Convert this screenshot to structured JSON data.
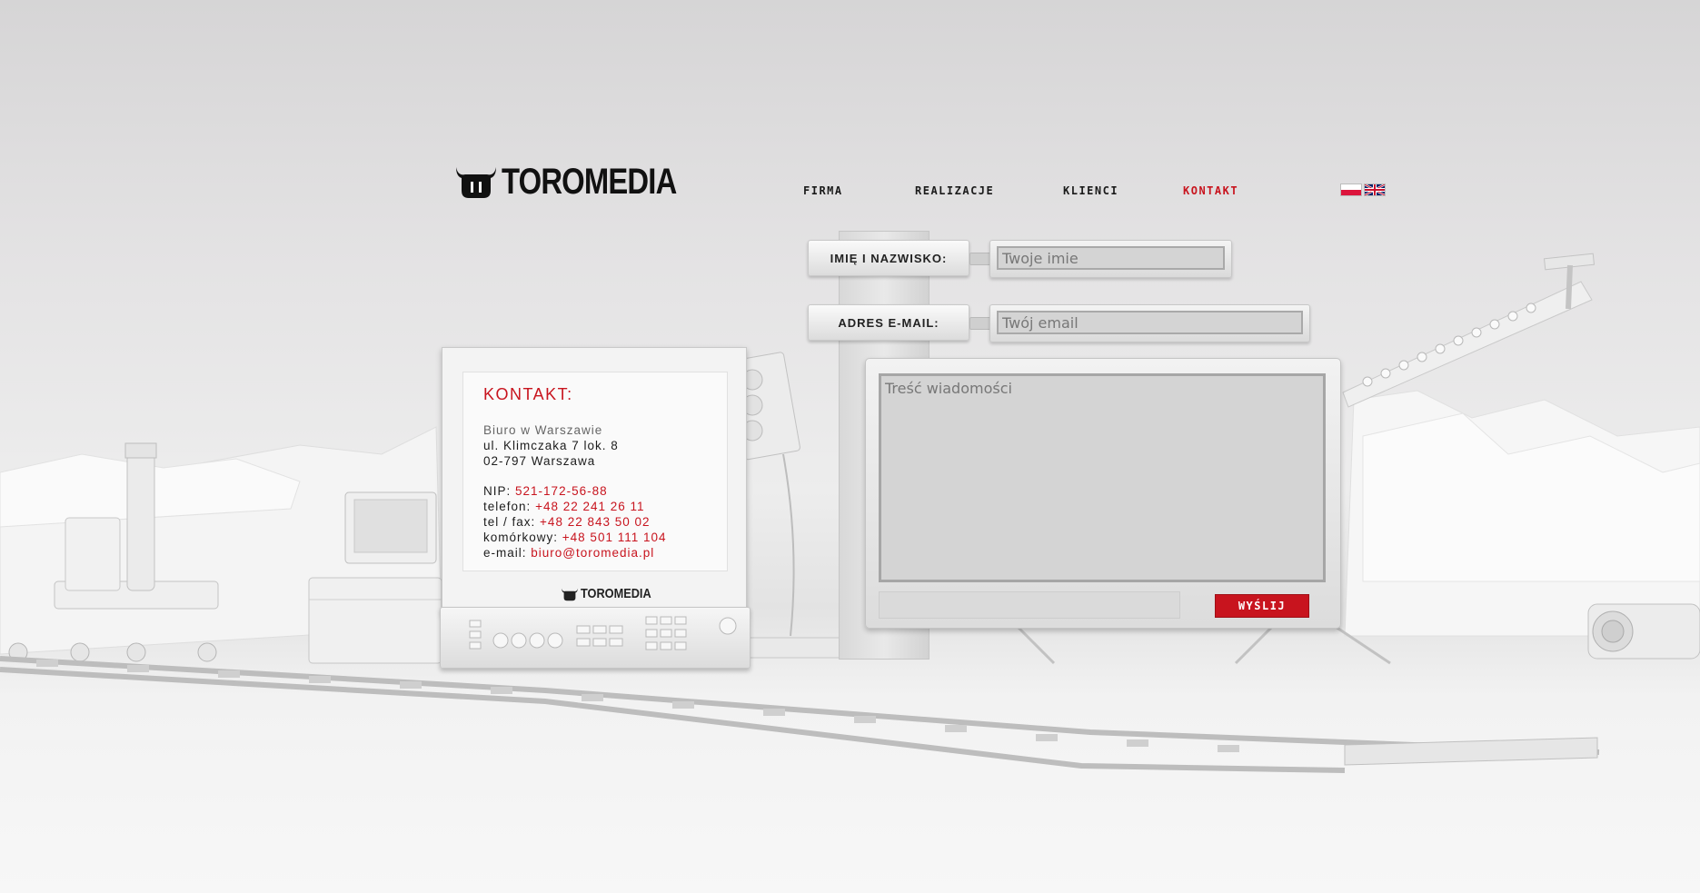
{
  "brand": {
    "name": "TOROMEDIA"
  },
  "nav": {
    "items": [
      {
        "label": "FIRMA",
        "active": false
      },
      {
        "label": "REALIZACJE",
        "active": false
      },
      {
        "label": "KLIENCI",
        "active": false
      },
      {
        "label": "KONTAKT",
        "active": true
      }
    ]
  },
  "languages": [
    {
      "code": "pl",
      "icon": "poland-flag-icon"
    },
    {
      "code": "en",
      "icon": "uk-flag-icon"
    }
  ],
  "form": {
    "name_label": "IMIĘ I NAZWISKO:",
    "name_placeholder": "Twoje imie",
    "email_label": "ADRES E-MAIL:",
    "email_placeholder": "Twój email",
    "message_placeholder": "Treść wiadomości",
    "submit_label": "WYŚLIJ"
  },
  "contact": {
    "title": "KONTAKT:",
    "office": "Biuro w Warszawie",
    "street": "ul. Klimczaka 7 lok. 8",
    "city": "02-797 Warszawa",
    "nip_label": "NIP:",
    "nip": "521-172-56-88",
    "phone_label": "telefon:",
    "phone": "+48 22 241 26 11",
    "fax_label": "tel / fax:",
    "fax": "+48 22 843 50 02",
    "mobile_label": "komórkowy:",
    "mobile": "+48 501 111 104",
    "email_label": "e-mail:",
    "email": "biuro@toromedia.pl"
  },
  "colors": {
    "accent": "#c8141e",
    "text": "#1a1a1a",
    "background": "#e8e8e8"
  }
}
